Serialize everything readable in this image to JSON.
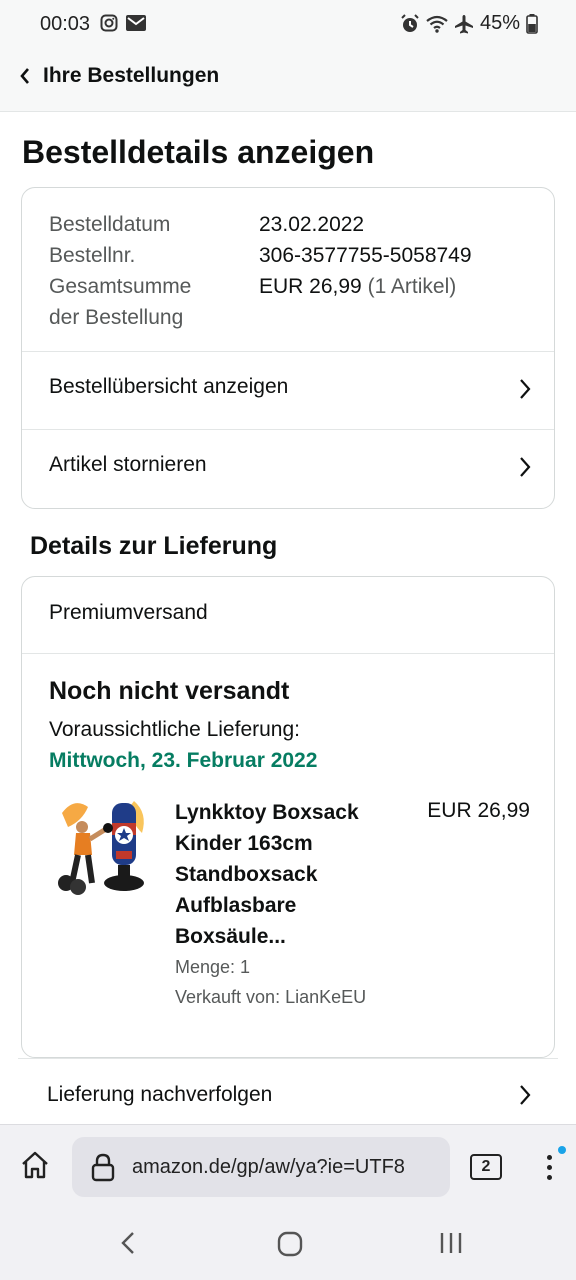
{
  "status_bar": {
    "time": "00:03",
    "battery": "45%",
    "icons": [
      "instagram-icon",
      "mail-icon",
      "alarm-icon",
      "wifi-icon",
      "airplane-icon",
      "battery-icon"
    ]
  },
  "header": {
    "title": "Ihre Bestellungen"
  },
  "page_title": "Bestelldetails anzeigen",
  "order_summary": {
    "date_label": "Bestelldatum",
    "date_value": "23.02.2022",
    "number_label": "Bestellnr.",
    "number_value": "306-3577755-5058749",
    "total_label_line1": "Gesamtsumme",
    "total_label_line2": "der Bestellung",
    "total_value": "EUR 26,99",
    "total_items": "(1 Artikel)",
    "links": [
      {
        "label": "Bestellübersicht anzeigen"
      },
      {
        "label": "Artikel stornieren"
      }
    ]
  },
  "delivery": {
    "section_title": "Details zur Lieferung",
    "shipping_method": "Premiumversand",
    "status": "Noch nicht versandt",
    "expected_label": "Voraussichtliche Lieferung:",
    "expected_date": "Mittwoch, 23. Februar 2022",
    "product": {
      "title_lines": [
        "Lynkktoy Boxsack",
        "Kinder 163cm",
        "Standboxsack",
        "Aufblasbare",
        "Boxsäule..."
      ],
      "price": "EUR 26,99",
      "quantity": "Menge: 1",
      "seller": "Verkauft von: LianKeEU"
    },
    "track_label": "Lieferung nachverfolgen"
  },
  "browser": {
    "url": "amazon.de/gp/aw/ya?ie=UTF8",
    "tab_count": "2"
  },
  "colors": {
    "delivery_green": "#067d62",
    "notification_dot": "#1aa3e8"
  }
}
